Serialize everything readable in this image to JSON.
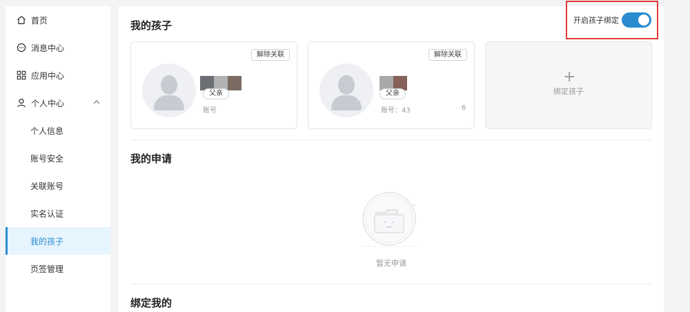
{
  "sidebar": {
    "home": "首页",
    "messages": "消息中心",
    "apps": "应用中心",
    "personal": "个人中心",
    "sub_items": [
      {
        "label": "个人信息"
      },
      {
        "label": "账号安全"
      },
      {
        "label": "关联账号"
      },
      {
        "label": "实名认证"
      },
      {
        "label": "我的孩子"
      },
      {
        "label": "页签管理"
      }
    ],
    "active_index": 4
  },
  "main": {
    "my_children_title": "我的孩子",
    "toggle_label": "开启孩子绑定",
    "toggle_on": true,
    "children": [
      {
        "unbind_label": "解除关联",
        "relation": "父亲",
        "account": "账号",
        "account_suffix": ""
      },
      {
        "unbind_label": "解除关联",
        "relation": "父亲",
        "account": "账号：43",
        "account_suffix": "6"
      }
    ],
    "bind_child_label": "绑定孩子",
    "bind_child_plus": "+",
    "my_requests_title": "我的申请",
    "requests_empty": "暂无申请",
    "bound_me_title": "绑定我的"
  },
  "colors": {
    "accent": "#2a8ccf",
    "highlight_border": "#e53935",
    "active_bg": "#e6f4fd"
  }
}
